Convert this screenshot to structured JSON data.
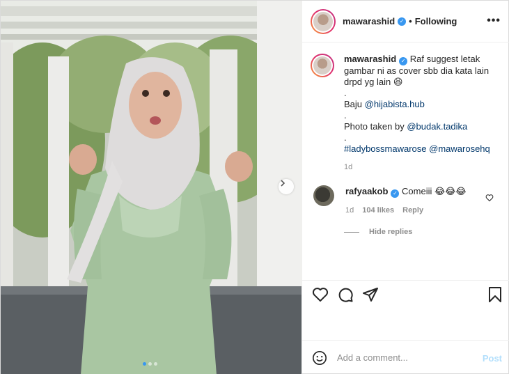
{
  "post": {
    "author": "mawarashid",
    "follow_status": "Following",
    "separator": "•",
    "more_label": "•••"
  },
  "caption": {
    "author": "mawarashid",
    "text": "Raf suggest letak gambar ni as cover sbb dia kata lain drpd yg lain 😆",
    "dot1": ".",
    "baju_label": "Baju",
    "baju_link": "@hijabista.hub",
    "dot2": ".",
    "photo_label": "Photo taken by",
    "photo_link": "@budak.tadika",
    "dot3": ".",
    "hashtag": "#ladybossmawarose",
    "mention": "@mawarosehq",
    "time": "1d"
  },
  "reply": {
    "author": "rafyaakob",
    "text": "Comeiii 😂😂😂",
    "time": "1d",
    "likes": "104 likes",
    "reply_label": "Reply",
    "hide_replies": "Hide replies"
  },
  "add_comment": {
    "placeholder": "Add a comment...",
    "post_label": "Post"
  },
  "icons": {
    "verified": "verified-badge-icon",
    "like": "heart-icon",
    "comment": "comment-bubble-icon",
    "share": "paper-plane-icon",
    "save": "bookmark-icon",
    "emoji": "smiley-icon",
    "next": "chevron-right-icon"
  },
  "colors": {
    "accent_blue": "#3897f0",
    "link": "#00376b",
    "muted": "#8e8e8e",
    "post_disabled": "#b2dffc"
  },
  "carousel": {
    "current": 1,
    "total": 3
  }
}
